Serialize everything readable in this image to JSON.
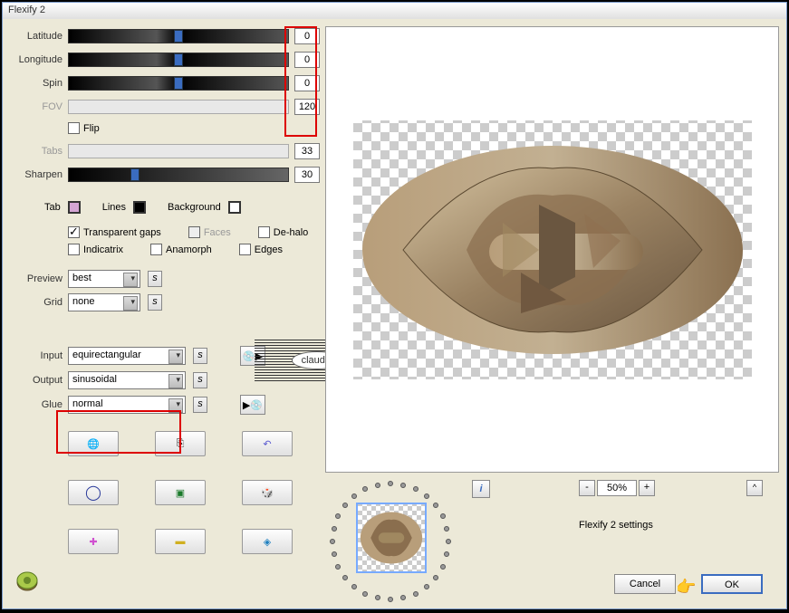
{
  "window": {
    "title": "Flexify 2"
  },
  "sliders": {
    "latitude": {
      "label": "Latitude",
      "value": "0"
    },
    "longitude": {
      "label": "Longitude",
      "value": "0"
    },
    "spin": {
      "label": "Spin",
      "value": "0"
    },
    "fov": {
      "label": "FOV",
      "value": "120"
    },
    "tabs": {
      "label": "Tabs",
      "value": "33"
    },
    "sharpen": {
      "label": "Sharpen",
      "value": "30"
    }
  },
  "checks": {
    "flip": "Flip",
    "transparent_gaps": "Transparent gaps",
    "faces": "Faces",
    "dehalo": "De-halo",
    "indicatrix": "Indicatrix",
    "anamorph": "Anamorph",
    "edges": "Edges"
  },
  "colors": {
    "tab": "Tab",
    "lines": "Lines",
    "background": "Background"
  },
  "selects": {
    "preview": {
      "label": "Preview",
      "value": "best"
    },
    "grid": {
      "label": "Grid",
      "value": "none"
    },
    "input": {
      "label": "Input",
      "value": "equirectangular"
    },
    "output": {
      "label": "Output",
      "value": "sinusoidal"
    },
    "glue": {
      "label": "Glue",
      "value": "normal"
    }
  },
  "s_label": "s",
  "zoom": {
    "minus": "-",
    "value": "50%",
    "plus": "+"
  },
  "collapse": "^",
  "info": "i",
  "settings_label": "Flexify 2 settings",
  "buttons": {
    "cancel": "Cancel",
    "ok": "OK"
  },
  "watermark": "claudia"
}
